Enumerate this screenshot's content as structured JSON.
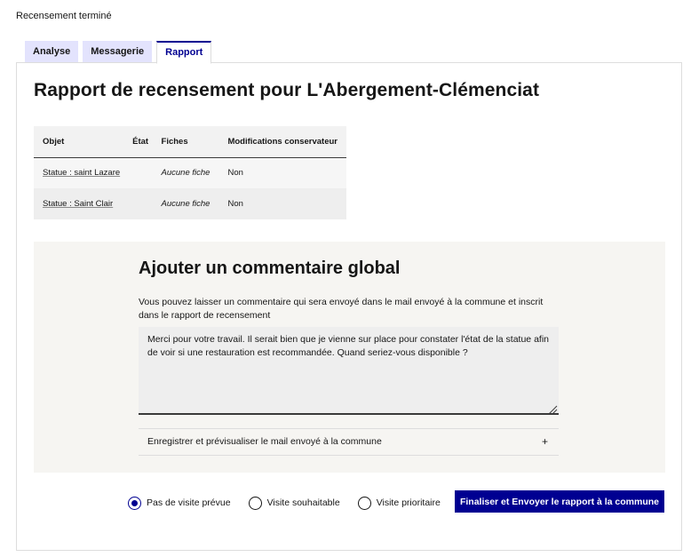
{
  "header": {
    "status": "Recensement terminé"
  },
  "tabs": [
    {
      "label": "Analyse"
    },
    {
      "label": "Messagerie"
    },
    {
      "label": "Rapport"
    }
  ],
  "report": {
    "title": "Rapport de recensement pour L'Abergement-Clémenciat",
    "table": {
      "columns": [
        "Objet",
        "État",
        "Fiches",
        "Modifications conservateur"
      ],
      "rows": [
        {
          "objet": "Statue : saint Lazare",
          "etat": "",
          "fiches": "Aucune fiche",
          "modifications": "Non"
        },
        {
          "objet": "Statue : Saint Clair",
          "etat": "",
          "fiches": "Aucune fiche",
          "modifications": "Non"
        }
      ]
    }
  },
  "comment": {
    "title": "Ajouter un commentaire global",
    "help": "Vous pouvez laisser un commentaire qui sera envoyé dans le mail envoyé à la commune et inscrit dans le rapport de recensement",
    "value": "Merci pour votre travail. Il serait bien que je vienne sur place pour constater l'état de la statue afin de voir si une restauration est recommandée. Quand seriez-vous disponible ?",
    "accordion_label": "Enregistrer et prévisualiser le mail envoyé à la commune",
    "accordion_icon": "+"
  },
  "visit_options": [
    {
      "label": "Pas de visite prévue",
      "checked": true
    },
    {
      "label": "Visite souhaitable",
      "checked": false
    },
    {
      "label": "Visite prioritaire",
      "checked": false
    }
  ],
  "actions": {
    "finalize_label": "Finaliser et Envoyer le rapport à la commune"
  },
  "colors": {
    "accent": "#000091",
    "tab_bg": "#e3e3fd",
    "comment_bg": "#f6f5f2"
  }
}
